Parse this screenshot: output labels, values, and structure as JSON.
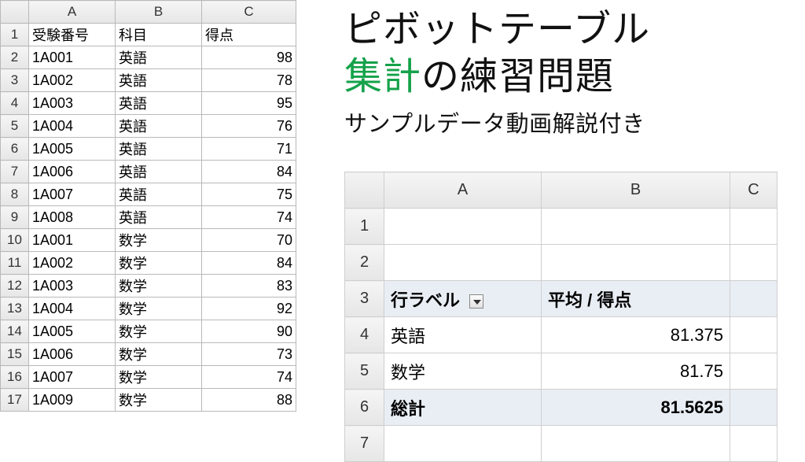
{
  "left_sheet": {
    "cols": [
      "A",
      "B",
      "C"
    ],
    "headers": {
      "a": "受験番号",
      "b": "科目",
      "c": "得点"
    },
    "rows": [
      {
        "n": "2",
        "a": "1A001",
        "b": "英語",
        "c": "98"
      },
      {
        "n": "3",
        "a": "1A002",
        "b": "英語",
        "c": "78"
      },
      {
        "n": "4",
        "a": "1A003",
        "b": "英語",
        "c": "95"
      },
      {
        "n": "5",
        "a": "1A004",
        "b": "英語",
        "c": "76"
      },
      {
        "n": "6",
        "a": "1A005",
        "b": "英語",
        "c": "71"
      },
      {
        "n": "7",
        "a": "1A006",
        "b": "英語",
        "c": "84"
      },
      {
        "n": "8",
        "a": "1A007",
        "b": "英語",
        "c": "75"
      },
      {
        "n": "9",
        "a": "1A008",
        "b": "英語",
        "c": "74"
      },
      {
        "n": "10",
        "a": "1A001",
        "b": "数学",
        "c": "70"
      },
      {
        "n": "11",
        "a": "1A002",
        "b": "数学",
        "c": "84"
      },
      {
        "n": "12",
        "a": "1A003",
        "b": "数学",
        "c": "83"
      },
      {
        "n": "13",
        "a": "1A004",
        "b": "数学",
        "c": "92"
      },
      {
        "n": "14",
        "a": "1A005",
        "b": "数学",
        "c": "90"
      },
      {
        "n": "15",
        "a": "1A006",
        "b": "数学",
        "c": "73"
      },
      {
        "n": "16",
        "a": "1A007",
        "b": "数学",
        "c": "74"
      },
      {
        "n": "17",
        "a": "1A009",
        "b": "数学",
        "c": "88"
      }
    ]
  },
  "title": {
    "line1": "ピボットテーブル",
    "accent": "集計",
    "line2_rest": "の練習問題",
    "subtitle": "サンプルデータ動画解説付き"
  },
  "pivot_sheet": {
    "cols": [
      "A",
      "B",
      "C"
    ],
    "header": {
      "row_label": "行ラベル",
      "value_label": "平均 / 得点"
    },
    "row_nums": {
      "r1": "1",
      "r2": "2",
      "r3": "3",
      "r4": "4",
      "r5": "5",
      "r6": "6",
      "r7": "7"
    },
    "data": [
      {
        "label": "英語",
        "value": "81.375"
      },
      {
        "label": "数学",
        "value": "81.75"
      }
    ],
    "total": {
      "label": "総計",
      "value": "81.5625"
    }
  }
}
